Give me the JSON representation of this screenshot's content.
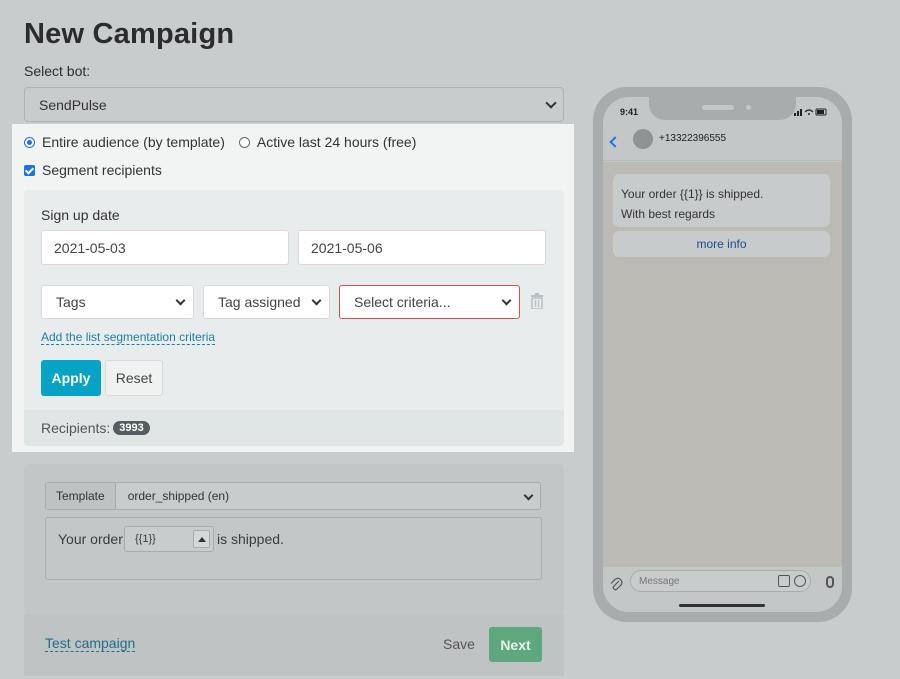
{
  "page": {
    "title": "New Campaign",
    "select_bot_label": "Select bot:",
    "bot_value": "SendPulse"
  },
  "audience": {
    "option_entire": "Entire audience (by template)",
    "option_active": "Active last 24 hours (free)",
    "selected": "entire",
    "segment_label": "Segment recipients",
    "segment_checked": true
  },
  "segment": {
    "signup_label": "Sign up date",
    "date_from": "2021-05-03",
    "date_to": "2021-05-06",
    "filter_field": "Tags",
    "filter_condition": "Tag assigned",
    "filter_criteria_placeholder": "Select criteria...",
    "add_link": "Add the list segmentation criteria",
    "apply": "Apply",
    "reset": "Reset",
    "recipients_label": "Recipients:",
    "recipients_count": "3993"
  },
  "template": {
    "tag": "Template",
    "value": "order_shipped (en)",
    "body_pre": "Your order",
    "var_value": "{{1}}",
    "body_post": "is shipped."
  },
  "footer": {
    "test_link": "Test campaign",
    "save": "Save",
    "next": "Next"
  },
  "phone": {
    "time": "9:41",
    "number": "+13322396555",
    "message_line1": "Your order {{1}} is shipped.",
    "message_line2": "With best regards",
    "button": "more info",
    "input_placeholder": "Message"
  },
  "colors": {
    "accent": "#06a3c4",
    "next_button": "#5fa87f",
    "error_border": "#d9534f",
    "link": "#1a80a8",
    "badge": "#555d60"
  }
}
